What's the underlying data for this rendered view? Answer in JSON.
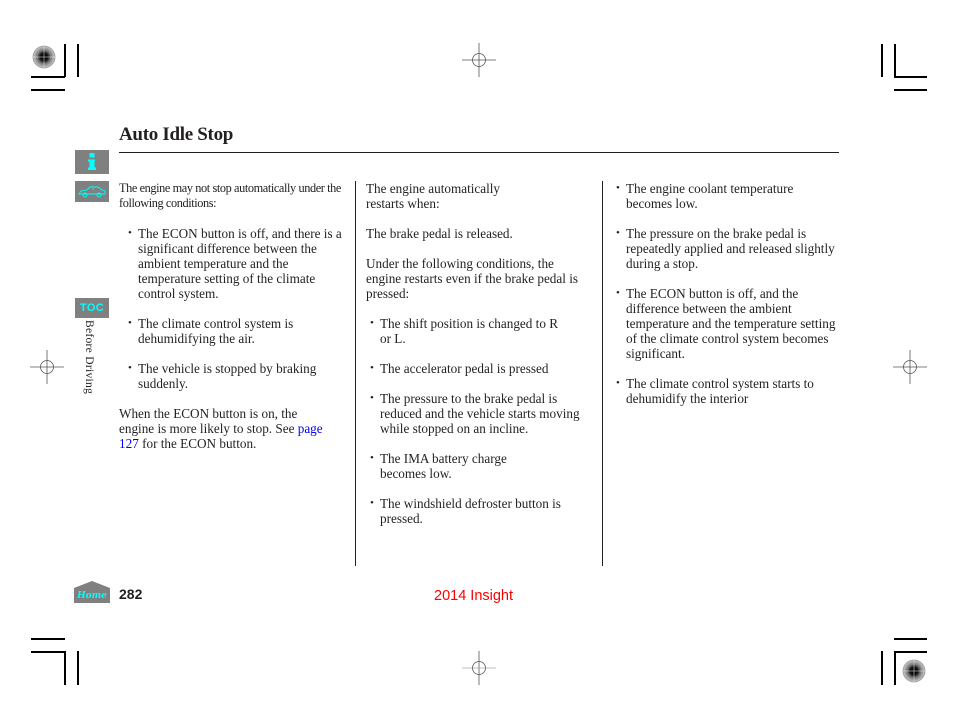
{
  "header": {
    "title": "Auto Idle Stop"
  },
  "sidebar": {
    "info_icon": "info-icon",
    "car_icon": "car-icon",
    "toc_label": "TOC",
    "section_label": "Before Driving",
    "home_label": "Home"
  },
  "columns": {
    "col1": {
      "intro": "The engine may not stop automatically under the following conditions:",
      "bullets": [
        "The ECON button is off, and there is a significant difference between the ambient temperature and the temperature setting of the climate control system.",
        "The climate control system is dehumidifying the air.",
        "The vehicle is stopped by braking suddenly."
      ],
      "note_before": "When the ECON button is on, the engine is more likely to stop. See",
      "note_link": "page 127",
      "note_after": "for the ECON button."
    },
    "col2": {
      "intro": "The engine automatically restarts when:",
      "para1": "The brake pedal is released.",
      "para2": "Under the following conditions, the engine restarts even if the brake pedal is pressed:",
      "bullets": [
        "The shift position is changed to R or L.",
        "The accelerator pedal is pressed",
        "The pressure to the brake pedal is reduced and the vehicle starts moving while stopped on an incline.",
        "The IMA battery charge becomes low.",
        "The windshield defroster button is pressed."
      ]
    },
    "col3": {
      "bullets": [
        "The engine coolant temperature becomes low.",
        "The pressure on the brake pedal is repeatedly applied and released slightly during a stop.",
        "The ECON button is off, and the difference between the ambient temperature and the temperature setting of the climate control system becomes significant.",
        "The climate control system starts to dehumidify the interior"
      ]
    }
  },
  "footer": {
    "page_number": "282",
    "doc_title": "2014 Insight"
  },
  "colors": {
    "sidebar_bg": "#808080",
    "sidebar_accent": "#00ffff",
    "link": "#0000ff",
    "footer_title": "#ff0000"
  }
}
